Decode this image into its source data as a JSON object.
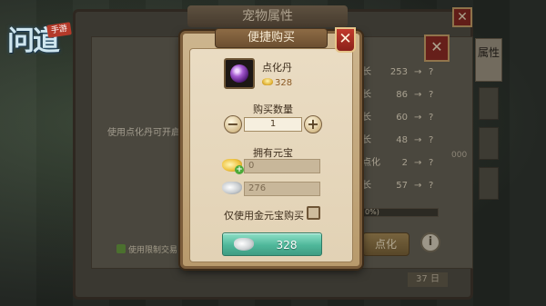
{
  "game": {
    "logo_text": "问道",
    "logo_tag": "手游"
  },
  "background_panel": {
    "title": "宠物属性",
    "close_glyph": "✕",
    "side_tab_label": "属性",
    "hint_text": "使用点化丹可开启",
    "stats": [
      {
        "label": "长",
        "value": "253",
        "arrow": "→",
        "next": "?"
      },
      {
        "label": "长",
        "value": "86",
        "arrow": "→",
        "next": "?"
      },
      {
        "label": "长",
        "value": "60",
        "arrow": "→",
        "next": "?"
      },
      {
        "label": "长",
        "value": "48",
        "arrow": "→",
        "next": "?"
      },
      {
        "label": "点化",
        "value": "2",
        "arrow": "→",
        "next": "?"
      },
      {
        "label": "长",
        "value": "57",
        "arrow": "→",
        "next": "?"
      }
    ],
    "extra_value": "000",
    "progress_text": "0%)",
    "refine_button": "点化",
    "info_button": "i",
    "checkbox_label": "使用限制交易",
    "bottom_button": "37 日"
  },
  "dialog": {
    "title": "便捷购买",
    "close_glyph": "✕",
    "item": {
      "name": "点化丹",
      "icon": "purple-orb-icon",
      "price": "328"
    },
    "quantity": {
      "label": "购买数量",
      "value": "1",
      "minus": "−",
      "plus": "+"
    },
    "owned": {
      "label": "拥有元宝",
      "gold_ingot": "0",
      "silver_ingot": "276"
    },
    "gold_only_label": "仅使用金元宝购买",
    "gold_only_checked": false,
    "buy_button_price": "328"
  },
  "colors": {
    "dialog_frame": "#7b5d3b",
    "dialog_paper": "#eadcc3",
    "buy_button": "#4fb79a",
    "close_red": "#c23a2c"
  }
}
